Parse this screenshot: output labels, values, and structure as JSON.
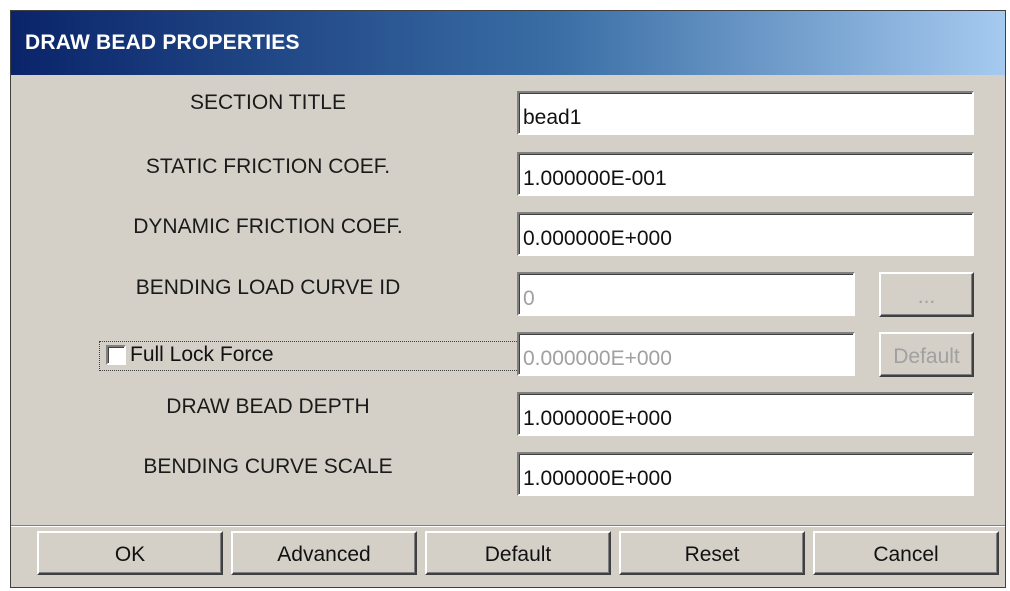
{
  "window": {
    "title": "DRAW BEAD PROPERTIES"
  },
  "form": {
    "section_title": {
      "label": "SECTION TITLE",
      "value": "bead1"
    },
    "static_friction": {
      "label": "STATIC FRICTION COEF.",
      "value": "1.000000E-001"
    },
    "dynamic_friction": {
      "label": "DYNAMIC FRICTION COEF.",
      "value": "0.000000E+000"
    },
    "bending_load_curve": {
      "label": "BENDING LOAD CURVE ID",
      "value": "0",
      "browse_label": "..."
    },
    "full_lock_force": {
      "label": "Full Lock Force",
      "checked": false,
      "value": "0.000000E+000",
      "default_label": "Default"
    },
    "draw_bead_depth": {
      "label": "DRAW BEAD DEPTH",
      "value": "1.000000E+000"
    },
    "bending_curve_scale": {
      "label": "BENDING CURVE SCALE",
      "value": "1.000000E+000"
    }
  },
  "buttons": {
    "ok": "OK",
    "advanced": "Advanced",
    "default": "Default",
    "reset": "Reset",
    "cancel": "Cancel"
  },
  "colors": {
    "title_bar_start": "#0a246a",
    "title_bar_end": "#a6caf0",
    "dialog_face": "#d4d0c8",
    "disabled_text": "#a0a0a0"
  }
}
